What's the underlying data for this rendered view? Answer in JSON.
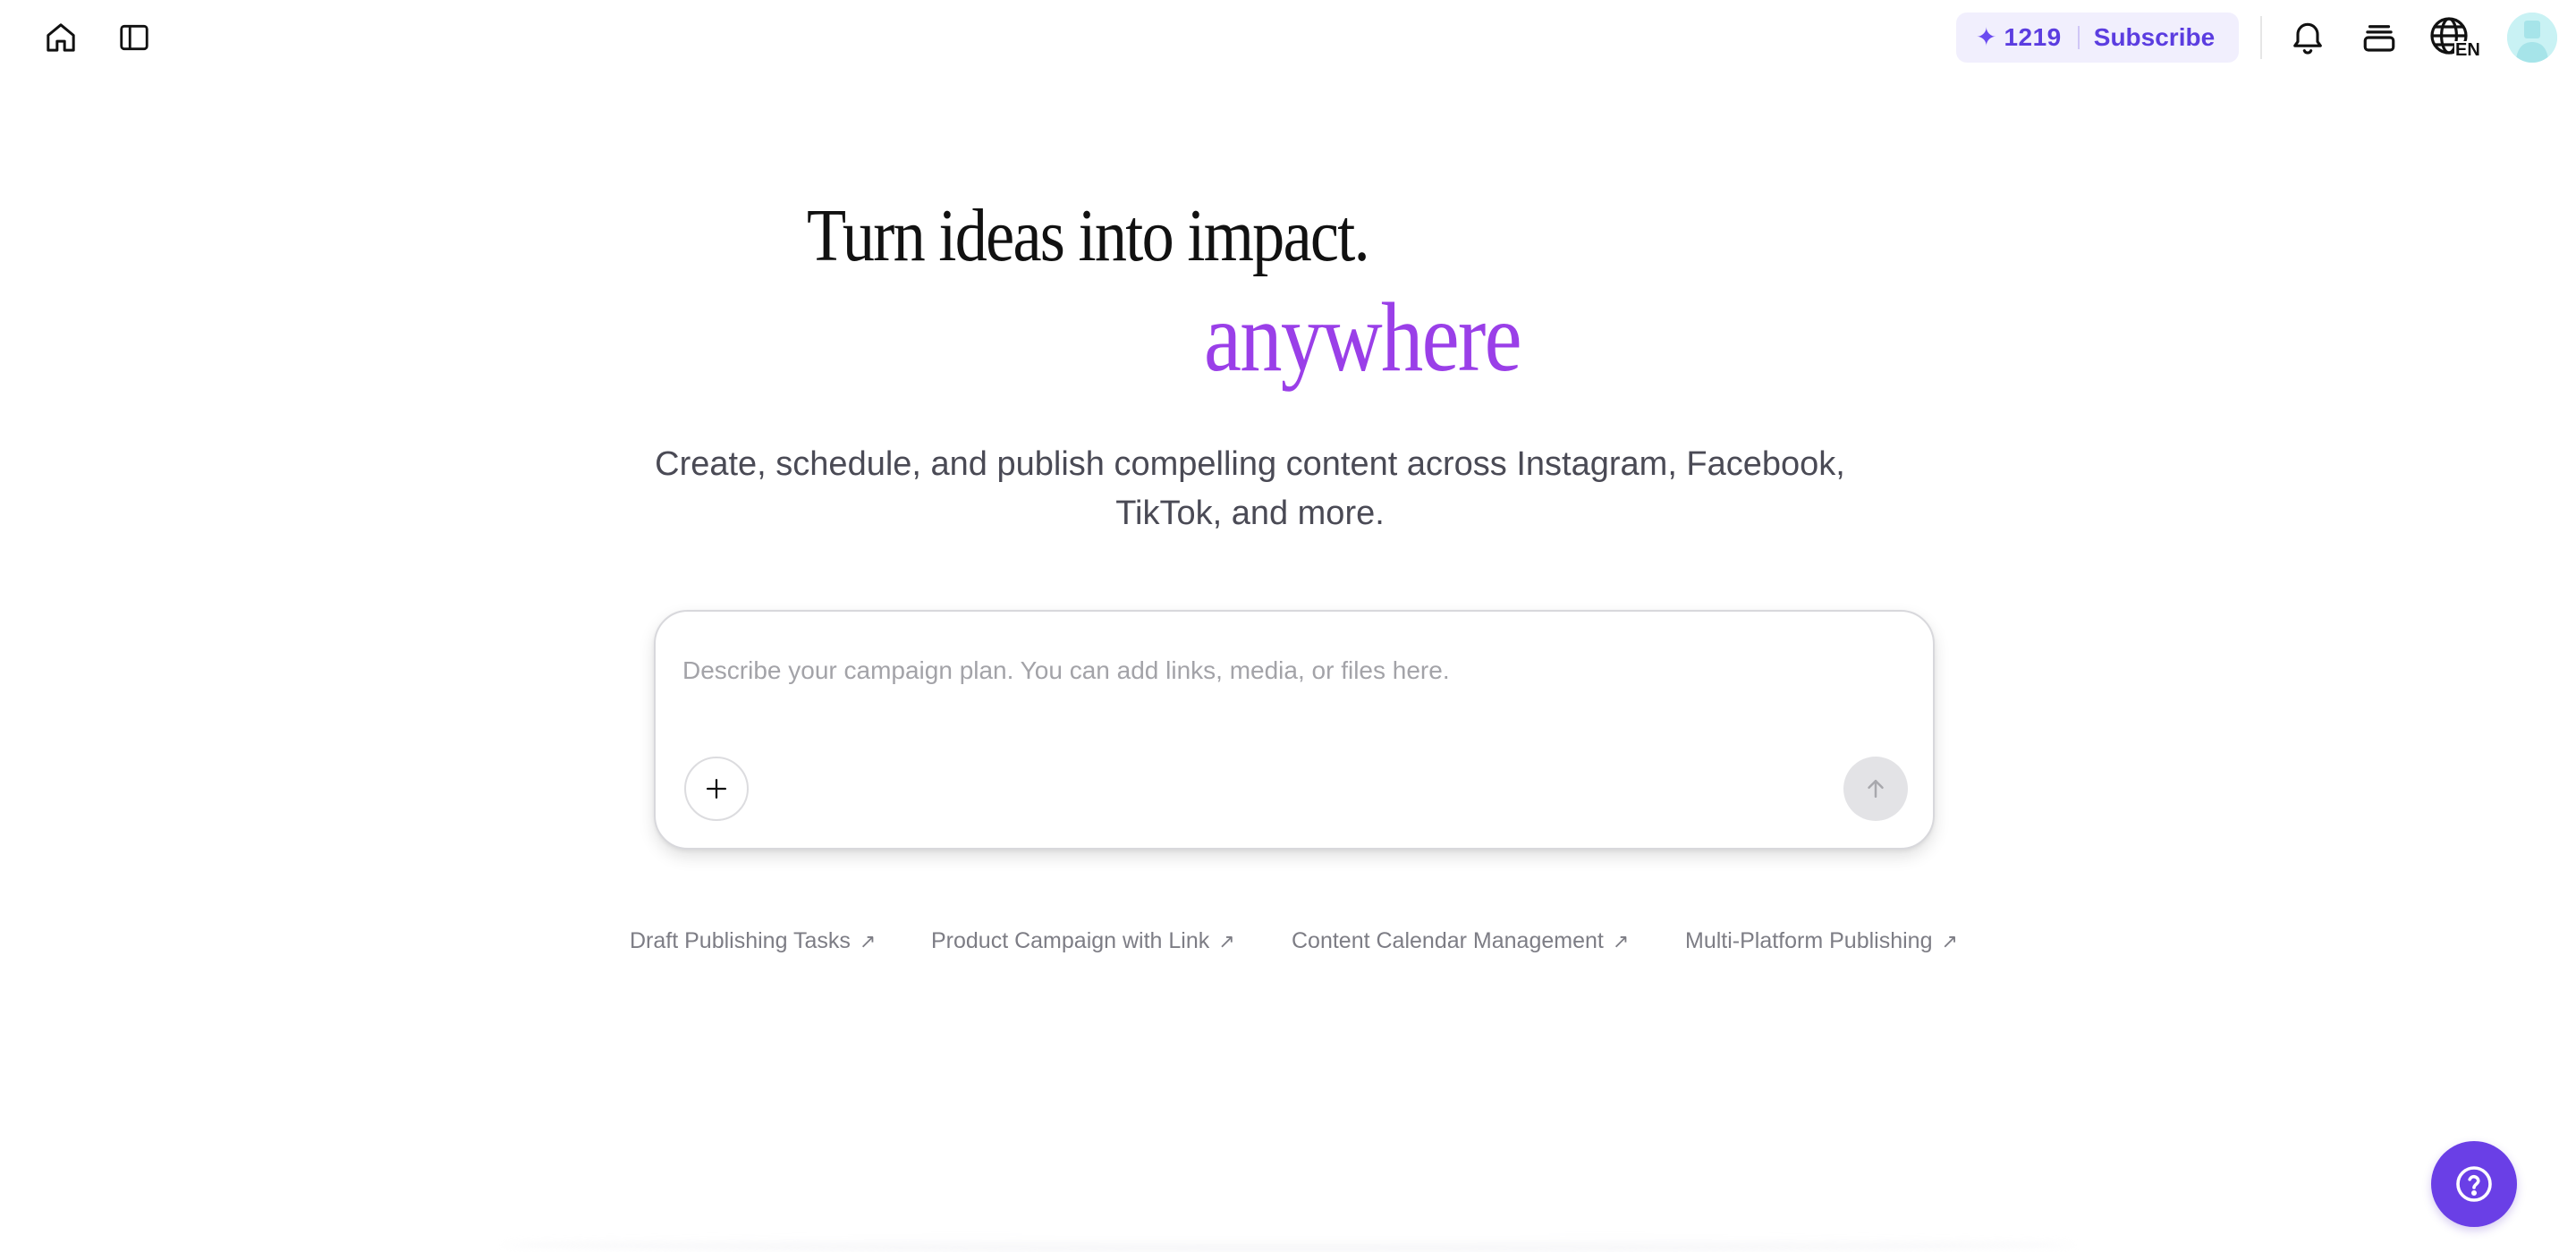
{
  "topbar": {
    "home_icon": "home-icon",
    "sidebar_icon": "sidebar-toggle-icon",
    "credits": {
      "icon": "sparkle-icon",
      "count": "1219",
      "subscribe_label": "Subscribe",
      "accent_color": "#5b3de0",
      "background_color": "#f1effd"
    },
    "notifications_icon": "bell-icon",
    "stack_icon": "stack-icon",
    "language": {
      "icon": "globe-icon",
      "label": "EN"
    },
    "avatar_icon": "avatar-icon"
  },
  "hero": {
    "title": "Turn ideas into impact.",
    "accent_word": "anywhere",
    "accent_color": "#9a3fe8",
    "subtitle": "Create, schedule, and publish compelling content across Instagram, Facebook, TikTok, and more."
  },
  "composer": {
    "placeholder": "Describe your campaign plan. You can add links, media, or files here.",
    "value": "",
    "attach_icon": "plus-icon",
    "send_icon": "arrow-up-icon"
  },
  "suggestions": [
    {
      "label": "Draft Publishing Tasks",
      "icon": "arrow-up-right-icon"
    },
    {
      "label": "Product Campaign with Link",
      "icon": "arrow-up-right-icon"
    },
    {
      "label": "Content Calendar Management",
      "icon": "arrow-up-right-icon"
    },
    {
      "label": "Multi-Platform Publishing",
      "icon": "arrow-up-right-icon"
    }
  ],
  "help": {
    "icon": "help-circle-icon",
    "color": "#6a3fe6"
  }
}
